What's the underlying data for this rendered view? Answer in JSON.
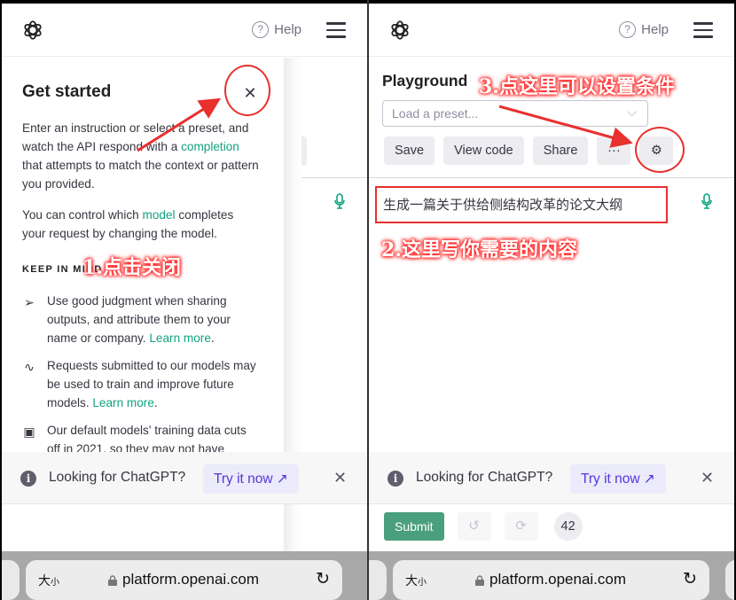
{
  "header": {
    "help_label": "Help",
    "help_icon": "question-circle-icon",
    "menu_icon": "hamburger-menu-icon",
    "logo_icon": "openai-logo-icon"
  },
  "drawer": {
    "title": "Get started",
    "close_icon": "close-icon",
    "intro_1_pre": "Enter an instruction or select a preset, and watch the API respond with a ",
    "intro_1_link": "completion",
    "intro_1_post": " that attempts to match the context or pattern you provided.",
    "intro_2_pre": "You can control which ",
    "intro_2_link": "model",
    "intro_2_post": " completes your request by changing the model.",
    "keep_in_mind_label": "KEEP IN MIND",
    "tips": [
      {
        "icon": "send-icon",
        "text": "Use good judgment when sharing outputs, and attribute them to your name or company. ",
        "link": "Learn more",
        "suffix": "."
      },
      {
        "icon": "activity-icon",
        "text": "Requests submitted to our models may be used to train and improve future models. ",
        "link": "Learn more",
        "suffix": "."
      },
      {
        "icon": "calendar-icon",
        "text": "Our default models' training data cuts off in 2021, so they may not have",
        "link": "",
        "suffix": ""
      }
    ]
  },
  "playground": {
    "title": "Playground",
    "preset_placeholder": "Load a preset...",
    "buttons": {
      "save": "Save",
      "view_code": "View code",
      "share": "Share",
      "more": "···",
      "settings_icon": "gear-icon"
    },
    "prompt_text": "生成一篇关于供给侧结构改革的论文大纲",
    "mic_icon": "microphone-icon",
    "submit_label": "Submit",
    "undo_icon": "undo-icon",
    "regenerate_icon": "regenerate-icon",
    "token_count": "42"
  },
  "banner": {
    "text": "Looking for ChatGPT?",
    "cta": "Try it now",
    "cta_icon": "external-link-icon",
    "close_icon": "close-icon"
  },
  "browser": {
    "text_size_label": "大",
    "text_size_small": "小",
    "url": "platform.openai.com",
    "lock_icon": "lock-icon",
    "reload_icon": "reload-icon"
  },
  "annotations": {
    "step1": "1.点击关闭",
    "step2": "2.这里写你需要的内容",
    "step3": "3.点这里可以设置条件"
  },
  "colors": {
    "accent_green": "#10a37f",
    "submit_green": "#4a9f7e",
    "link_purple": "#5436da",
    "annotation_red": "#e8302e"
  }
}
